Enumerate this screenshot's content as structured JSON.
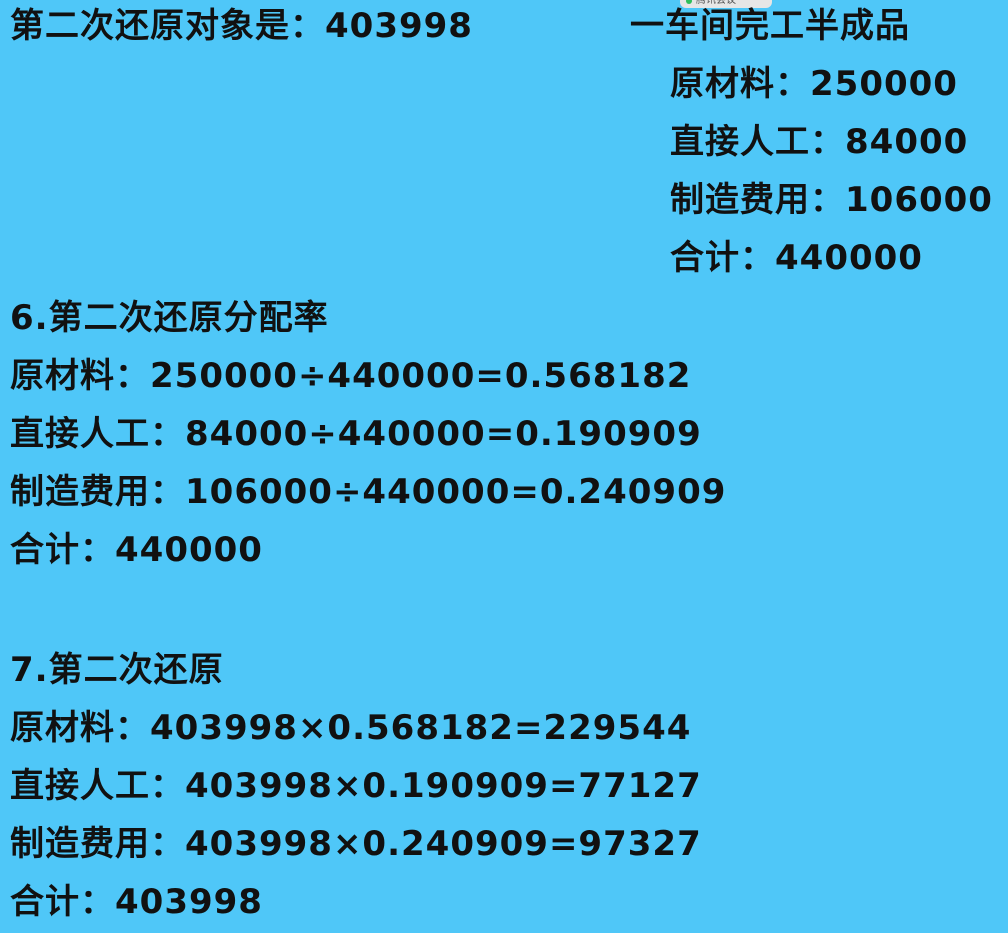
{
  "overlay_badge": {
    "text": "腾讯会议",
    "color": "#2fbf5a"
  },
  "colors": {
    "background": "#4fc7f8",
    "text": "#111111"
  },
  "header": {
    "left_text": "第二次还原对象是：403998",
    "right_title": "一车间完工半成品",
    "right_items": [
      "原材料：250000",
      "直接人工：84000",
      "制造费用：106000",
      "合计：440000"
    ]
  },
  "section6": {
    "title": "6.第二次还原分配率",
    "lines": [
      "原材料：250000÷440000=0.568182",
      "直接人工：84000÷440000=0.190909",
      "制造费用：106000÷440000=0.240909",
      "合计：440000"
    ]
  },
  "section7": {
    "title": "7.第二次还原",
    "lines": [
      "原材料：403998×0.568182=229544",
      "直接人工：403998×0.190909=77127",
      "制造费用：403998×0.240909=97327",
      "合计：403998"
    ]
  }
}
